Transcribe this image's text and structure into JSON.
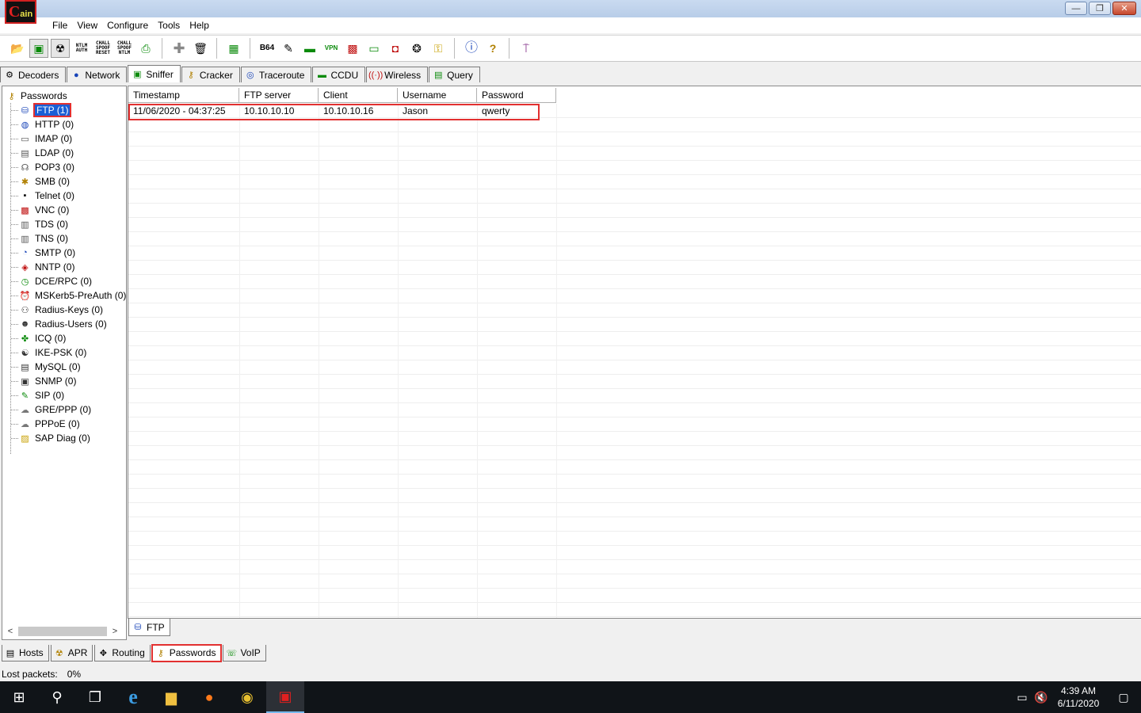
{
  "app": {
    "logo_text": "ain"
  },
  "window_controls": {
    "minimize": "—",
    "restore": "❐",
    "close": "✕"
  },
  "menu": [
    "File",
    "View",
    "Configure",
    "Tools",
    "Help"
  ],
  "toolbar": {
    "ntlm_auth": "NTLM AUTH",
    "chall_spoof_reset": "CHALL SPOOF RESET",
    "chall_spoof_ntlm": "CHALL SPOOF NTLM",
    "base64": "B64",
    "vpn": "VPN"
  },
  "top_tabs": [
    {
      "label": "Decoders",
      "icon": "decoders-icon"
    },
    {
      "label": "Network",
      "icon": "network-icon"
    },
    {
      "label": "Sniffer",
      "icon": "sniffer-icon",
      "active": true
    },
    {
      "label": "Cracker",
      "icon": "cracker-icon"
    },
    {
      "label": "Traceroute",
      "icon": "traceroute-icon"
    },
    {
      "label": "CCDU",
      "icon": "ccdu-icon"
    },
    {
      "label": "Wireless",
      "icon": "wireless-icon"
    },
    {
      "label": "Query",
      "icon": "query-icon"
    }
  ],
  "tree": {
    "root": "Passwords",
    "items": [
      {
        "label": "FTP (1)",
        "selected": true
      },
      {
        "label": "HTTP (0)"
      },
      {
        "label": "IMAP (0)"
      },
      {
        "label": "LDAP (0)"
      },
      {
        "label": "POP3 (0)"
      },
      {
        "label": "SMB (0)"
      },
      {
        "label": "Telnet (0)"
      },
      {
        "label": "VNC (0)"
      },
      {
        "label": "TDS (0)"
      },
      {
        "label": "TNS (0)"
      },
      {
        "label": "SMTP (0)"
      },
      {
        "label": "NNTP (0)"
      },
      {
        "label": "DCE/RPC (0)"
      },
      {
        "label": "MSKerb5-PreAuth (0)"
      },
      {
        "label": "Radius-Keys (0)"
      },
      {
        "label": "Radius-Users (0)"
      },
      {
        "label": "ICQ (0)"
      },
      {
        "label": "IKE-PSK (0)"
      },
      {
        "label": "MySQL (0)"
      },
      {
        "label": "SNMP (0)"
      },
      {
        "label": "SIP (0)"
      },
      {
        "label": "GRE/PPP (0)"
      },
      {
        "label": "PPPoE (0)"
      },
      {
        "label": "SAP Diag (0)"
      }
    ]
  },
  "table": {
    "columns": [
      "Timestamp",
      "FTP server",
      "Client",
      "Username",
      "Password"
    ],
    "rows": [
      [
        "11/06/2020 - 04:37:25",
        "10.10.10.10",
        "10.10.10.16",
        "Jason",
        "qwerty"
      ]
    ]
  },
  "sub_tab": {
    "label": "FTP"
  },
  "bottom_tabs": [
    {
      "label": "Hosts"
    },
    {
      "label": "APR"
    },
    {
      "label": "Routing"
    },
    {
      "label": "Passwords",
      "active": true
    },
    {
      "label": "VoIP"
    }
  ],
  "status": {
    "label": "Lost packets:",
    "value": "0%"
  },
  "taskbar": {
    "time": "4:39 AM",
    "date": "6/11/2020"
  },
  "colors": {
    "selection": "#1a5fd6",
    "highlight_box": "#e23030"
  }
}
